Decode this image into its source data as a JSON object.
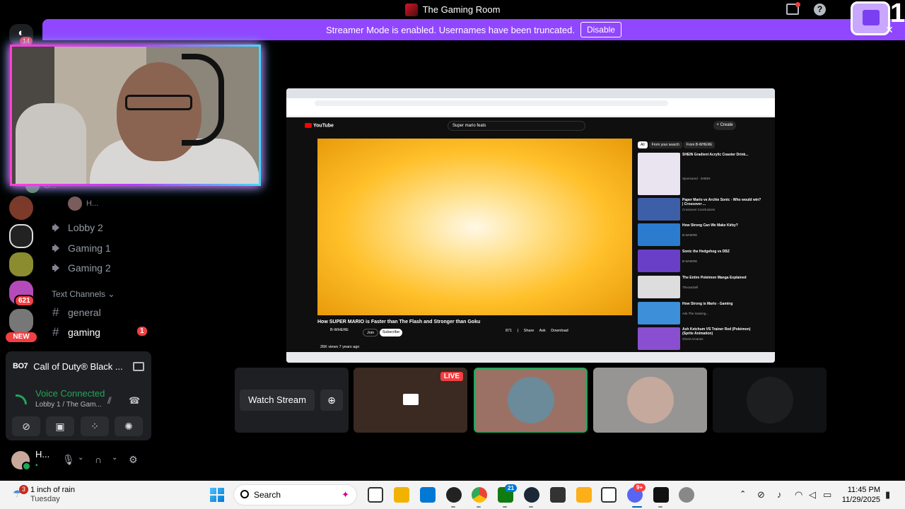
{
  "titlebar": {
    "title": "The Gaming Room"
  },
  "banner": {
    "text": "Streamer Mode is enabled. Usernames have been truncated.",
    "disable_label": "Disable"
  },
  "overlay": {
    "twitch_count": "1"
  },
  "rail": {
    "home_badge": "14",
    "server_badge": "621",
    "new_label": "NEW"
  },
  "channels": {
    "users": [
      {
        "name": "G..."
      },
      {
        "name": "H..."
      }
    ],
    "voice": [
      {
        "label": "Lobby 2"
      },
      {
        "label": "Gaming 1"
      },
      {
        "label": "Gaming 2"
      }
    ],
    "text_header": "Text Channels",
    "text": [
      {
        "label": "general"
      },
      {
        "label": "gaming",
        "badge": "1"
      }
    ]
  },
  "activity": {
    "game": "Call of Duty® Black ...",
    "icon_text": "BO7"
  },
  "voice_panel": {
    "status": "Voice Connected",
    "channel": "Lobby 1 / The Gam..."
  },
  "user_panel": {
    "name": "H..."
  },
  "stream": {
    "search_query": "Super mario feats",
    "yt_logo": "YouTube",
    "create_label": "+ Create",
    "video_title": "How SUPER MARIO is Faster than The Flash and Stronger than Goku",
    "channel_name": "B-WHERE",
    "join": "Join",
    "subscribe": "Subscribe",
    "actions": "871 | Share Ask Download",
    "views": "26K views  7 years ago",
    "chips": [
      "All",
      "From your search",
      "From B-WHERE"
    ],
    "recs": [
      {
        "title": "SHEIN Gradient Acrylic Coaster Drink...",
        "meta": "Sponsored · SHEIN"
      },
      {
        "title": "Paper Mario vs Archie Sonic - Who would win? | Crossover ...",
        "meta": "Crossover Conclusions"
      },
      {
        "title": "How Strong Can We Make Kirby?",
        "meta": "B-WHERE"
      },
      {
        "title": "Sonic the Hedgehog vs DBZ",
        "meta": "B-WHERE"
      },
      {
        "title": "The Entire Pokémon Manga Explained",
        "meta": "TheJoeZell"
      },
      {
        "title": "How Strong is Mario - Gaming",
        "meta": "Ask The Gaming..."
      },
      {
        "title": "Ash Ketchum VS Trainer Red (Pokémon) (Sprite Animation)",
        "meta": "Ghost Arcanes"
      }
    ]
  },
  "tiles": {
    "watch_label": "Watch Stream",
    "live_label": "LIVE"
  },
  "taskbar": {
    "weather_badge": "3",
    "weather_line1": "1 inch of rain",
    "weather_line2": "Tuesday",
    "search_placeholder": "Search",
    "discord_badge": "9+",
    "xbox_badge": "21",
    "time": "11:45 PM",
    "date": "11/29/2025"
  }
}
